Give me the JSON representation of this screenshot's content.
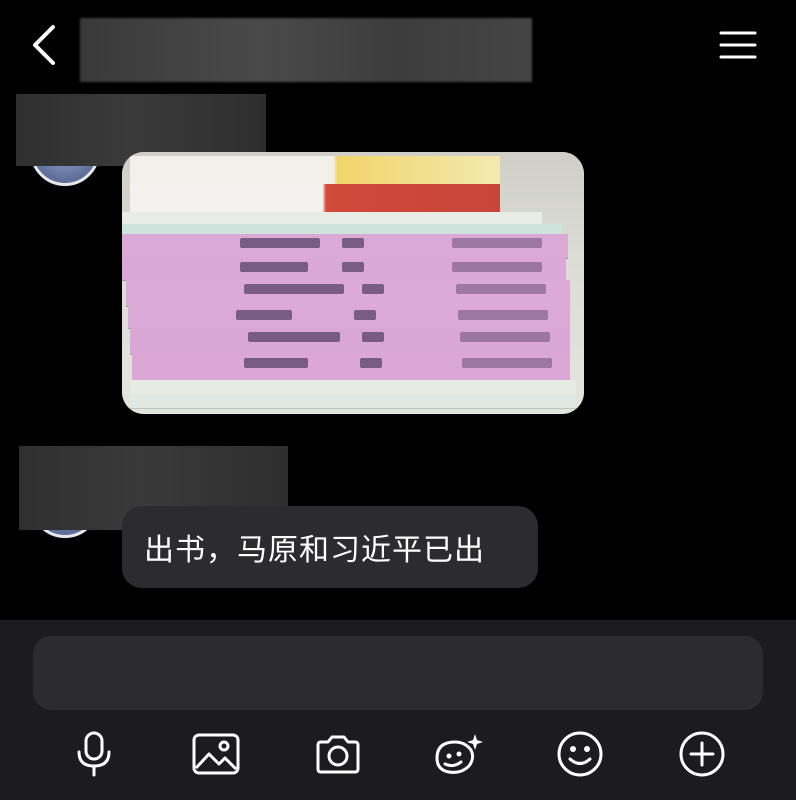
{
  "header": {
    "back_icon": "chevron-left-icon",
    "menu_icon": "hamburger-menu-icon"
  },
  "messages": [
    {
      "type": "image",
      "description_icon": "photo-of-books"
    },
    {
      "type": "text",
      "text": "出书，马原和习近平已出"
    }
  ],
  "composer": {
    "input_value": "",
    "tools": [
      "microphone-icon",
      "image-icon",
      "camera-icon",
      "sticker-icon",
      "emoji-icon",
      "plus-icon"
    ]
  },
  "colors": {
    "background": "#000000",
    "bubble": "#2c2c2e",
    "composer": "#1c1c1e",
    "book_pink": "#d9a8d6",
    "book_red": "#c8453a"
  }
}
